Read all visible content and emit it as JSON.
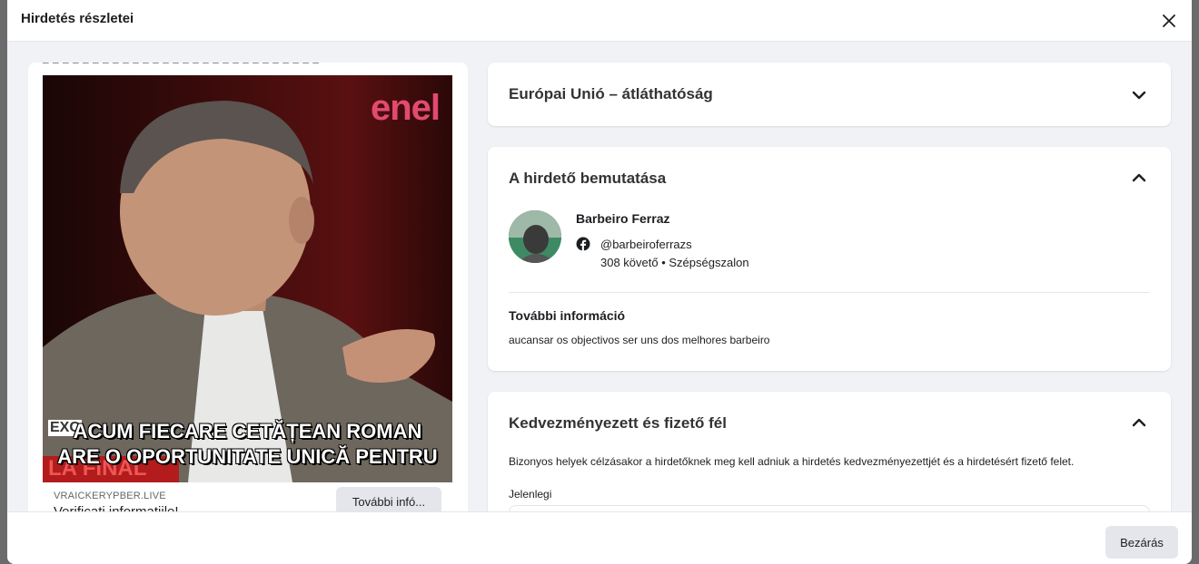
{
  "modal": {
    "title": "Hirdetés részletei",
    "close_icon": "close-icon"
  },
  "ad": {
    "cut_text": "– – –  – –  – – – – – – – – – – –  – – – – –  – –  – – – – –",
    "logo": "enel",
    "subtitle_line1": "ACUM FIECARE CETĂȚEAN ROMAN",
    "subtitle_line2": "ARE O OPORTUNITATE UNICĂ PENTRU",
    "exc_tag": "EXC",
    "lafinal_tag": "LA FINAL",
    "domain": "VRAICKERYPBER.LIVE",
    "headline": "Verificati informatiile!",
    "cta_label": "További infó..."
  },
  "sections": {
    "eu": {
      "title": "Európai Unió – átláthatóság",
      "chevron": "chevron-down-icon"
    },
    "advertiser": {
      "title": "A hirdető bemutatása",
      "chevron": "chevron-up-icon",
      "name": "Barbeiro Ferraz",
      "platform_icon": "facebook-icon",
      "handle": "@barbeiroferrazs",
      "meta": "308 követő • Szépségszalon",
      "more_title": "További információ",
      "more_text": "aucansar os objectivos ser uns dos melhores barbeiro"
    },
    "payer": {
      "title": "Kedvezményezett és fizető fél",
      "chevron": "chevron-up-icon",
      "description": "Bizonyos helyek célzásakor a hirdetőknek meg kell adniuk a hirdetés kedvezményezettjét és a hirdetésért fizető felet.",
      "current_label": "Jelenlegi"
    }
  },
  "footer": {
    "close_label": "Bezárás"
  },
  "colors": {
    "background": "#f0f2f5",
    "card": "#ffffff",
    "button": "#e4e6eb",
    "text": "#1c1e21",
    "muted": "#65676b"
  }
}
